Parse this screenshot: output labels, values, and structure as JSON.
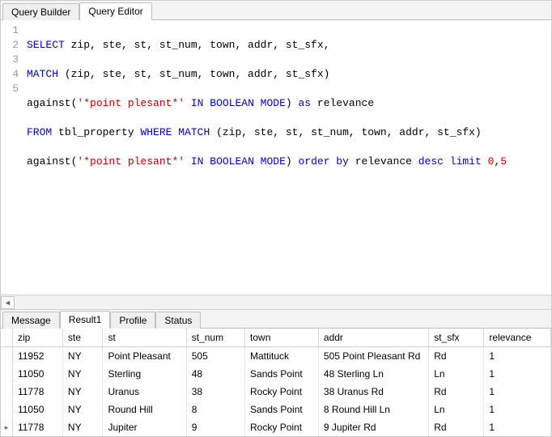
{
  "top_tabs": {
    "builder": "Query Builder",
    "editor": "Query Editor"
  },
  "code": {
    "lines": [
      "1",
      "2",
      "3",
      "4",
      "5"
    ],
    "l1": {
      "select": "SELECT",
      "cols": " zip, ste, st, st_num, town, addr, st_sfx,"
    },
    "l2": {
      "match": "MATCH",
      "args": " (zip, ste, st, st_num, town, addr, st_sfx)"
    },
    "l3": {
      "against": "against(",
      "str": "'*point plesant*'",
      "in": " IN ",
      "boolean": "BOOLEAN",
      "mode": " MODE",
      "paren": ") ",
      "as": "as",
      "alias": " relevance"
    },
    "l4": {
      "from": "FROM",
      "tbl": " tbl_property ",
      "where": "WHERE",
      "match": " MATCH",
      "args": " (zip, ste, st, st_num, town, addr, st_sfx)"
    },
    "l5": {
      "against": "against(",
      "str": "'*point plesant*'",
      "in": " IN ",
      "boolean": "BOOLEAN",
      "mode": " MODE",
      "paren": ") ",
      "orderby": "order by",
      "col": " relevance ",
      "desc": "desc",
      "limit": " limit ",
      "n0": "0",
      "comma": ",",
      "n1": "5"
    }
  },
  "bottom_tabs": {
    "message": "Message",
    "result1": "Result1",
    "profile": "Profile",
    "status": "Status"
  },
  "grid": {
    "headers": {
      "zip": "zip",
      "ste": "ste",
      "st": "st",
      "st_num": "st_num",
      "town": "town",
      "addr": "addr",
      "st_sfx": "st_sfx",
      "relevance": "relevance"
    },
    "rows": [
      {
        "zip": "11952",
        "ste": "NY",
        "st": "Point Pleasant",
        "st_num": "505",
        "town": "Mattituck",
        "addr": "505 Point Pleasant Rd",
        "st_sfx": "Rd",
        "relevance": "1"
      },
      {
        "zip": "11050",
        "ste": "NY",
        "st": "Sterling",
        "st_num": "48",
        "town": "Sands Point",
        "addr": "48 Sterling Ln",
        "st_sfx": "Ln",
        "relevance": "1"
      },
      {
        "zip": "11778",
        "ste": "NY",
        "st": "Uranus",
        "st_num": "38",
        "town": "Rocky Point",
        "addr": "38 Uranus Rd",
        "st_sfx": "Rd",
        "relevance": "1"
      },
      {
        "zip": "11050",
        "ste": "NY",
        "st": "Round Hill",
        "st_num": "8",
        "town": "Sands Point",
        "addr": "8 Round Hill Ln",
        "st_sfx": "Ln",
        "relevance": "1"
      },
      {
        "zip": "11778",
        "ste": "NY",
        "st": "Jupiter",
        "st_num": "9",
        "town": "Rocky Point",
        "addr": "9 Jupiter Rd",
        "st_sfx": "Rd",
        "relevance": "1"
      }
    ],
    "current_row_marker": "▸"
  }
}
